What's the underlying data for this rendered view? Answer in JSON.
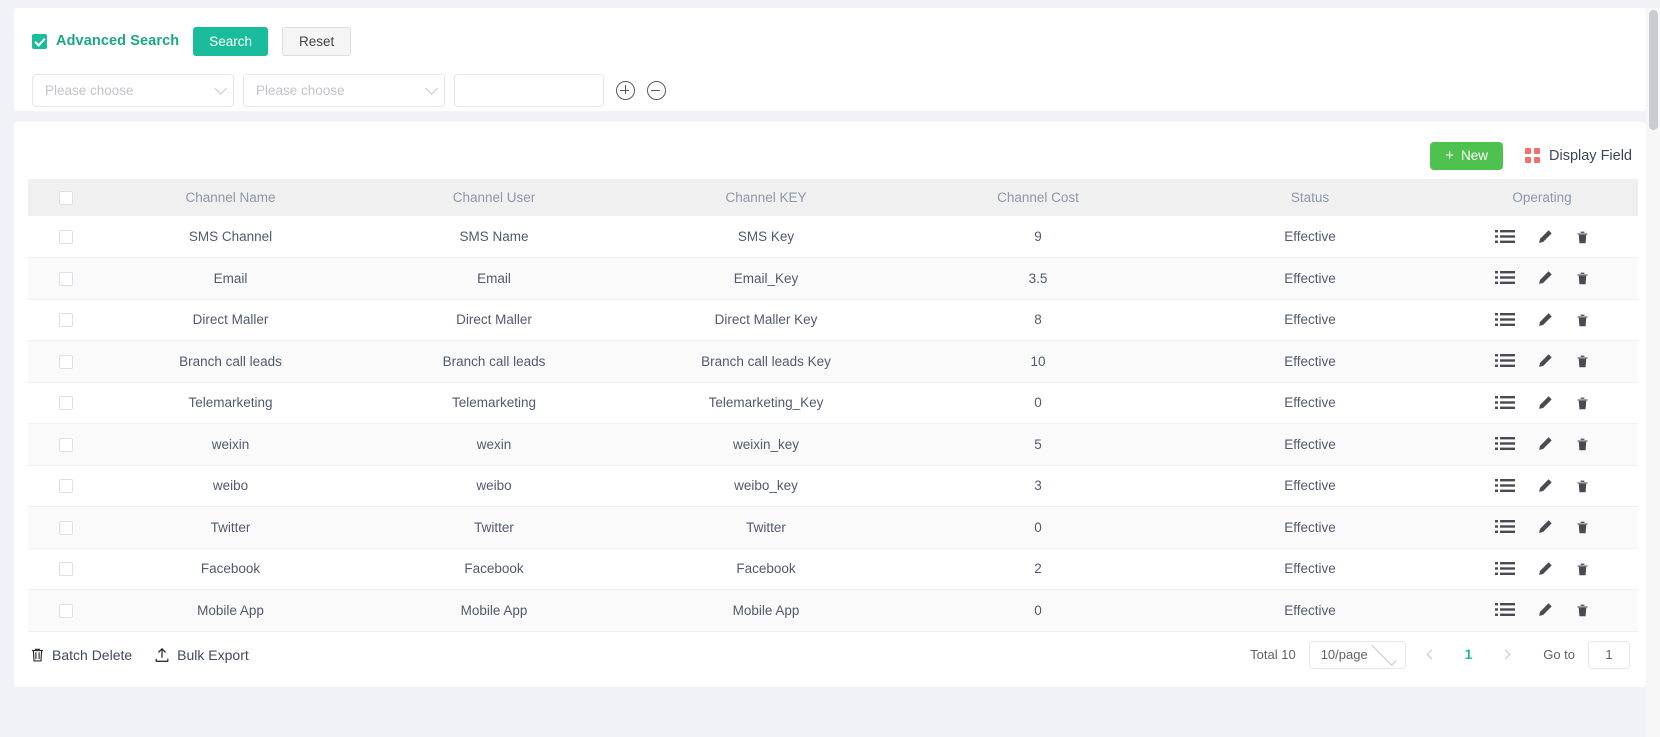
{
  "search": {
    "advanced_label": "Advanced Search",
    "checkbox_checked": true,
    "search_button": "Search",
    "reset_button": "Reset",
    "filter_field_placeholder": "Please choose",
    "filter_operator_placeholder": "Please choose",
    "filter_value": "",
    "add_icon": "plus-circle-icon",
    "remove_icon": "minus-circle-icon"
  },
  "toolbar": {
    "new_label": "New",
    "new_prefix": "+",
    "display_field_label": "Display Field",
    "display_field_icon": "grid-icon"
  },
  "table": {
    "columns": [
      "Channel Name",
      "Channel User",
      "Channel KEY",
      "Channel Cost",
      "Status",
      "Operating"
    ],
    "rows": [
      {
        "name": "SMS Channel",
        "user": "SMS Name",
        "key": "SMS Key",
        "cost": "9",
        "status": "Effective"
      },
      {
        "name": "Email",
        "user": "Email",
        "key": "Email_Key",
        "cost": "3.5",
        "status": "Effective"
      },
      {
        "name": "Direct Maller",
        "user": "Direct Maller",
        "key": "Direct Maller Key",
        "cost": "8",
        "status": "Effective"
      },
      {
        "name": "Branch call leads",
        "user": "Branch call leads",
        "key": "Branch call leads Key",
        "cost": "10",
        "status": "Effective"
      },
      {
        "name": "Telemarketing",
        "user": "Telemarketing",
        "key": "Telemarketing_Key",
        "cost": "0",
        "status": "Effective"
      },
      {
        "name": "weixin",
        "user": "wexin",
        "key": "weixin_key",
        "cost": "5",
        "status": "Effective"
      },
      {
        "name": "weibo",
        "user": "weibo",
        "key": "weibo_key",
        "cost": "3",
        "status": "Effective"
      },
      {
        "name": "Twitter",
        "user": "Twitter",
        "key": "Twitter",
        "cost": "0",
        "status": "Effective"
      },
      {
        "name": "Facebook",
        "user": "Facebook",
        "key": "Facebook",
        "cost": "2",
        "status": "Effective"
      },
      {
        "name": "Mobile App",
        "user": "Mobile App",
        "key": "Mobile App",
        "cost": "0",
        "status": "Effective"
      }
    ],
    "row_icons": [
      "detail-list-icon",
      "edit-pencil-icon",
      "delete-trash-icon"
    ]
  },
  "footer": {
    "batch_delete_label": "Batch Delete",
    "batch_delete_icon": "trash-icon",
    "bulk_export_label": "Bulk Export",
    "bulk_export_icon": "upload-icon",
    "total_label": "Total 10",
    "page_size": "10/page",
    "current_page": "1",
    "goto_label": "Go to",
    "goto_value": "1"
  },
  "colors": {
    "accent_teal": "#1abc9c",
    "new_green": "#4fc14e",
    "display_red": "#f2706b",
    "header_bg": "#f0f0f0",
    "page_bg": "#f0f2f5"
  }
}
